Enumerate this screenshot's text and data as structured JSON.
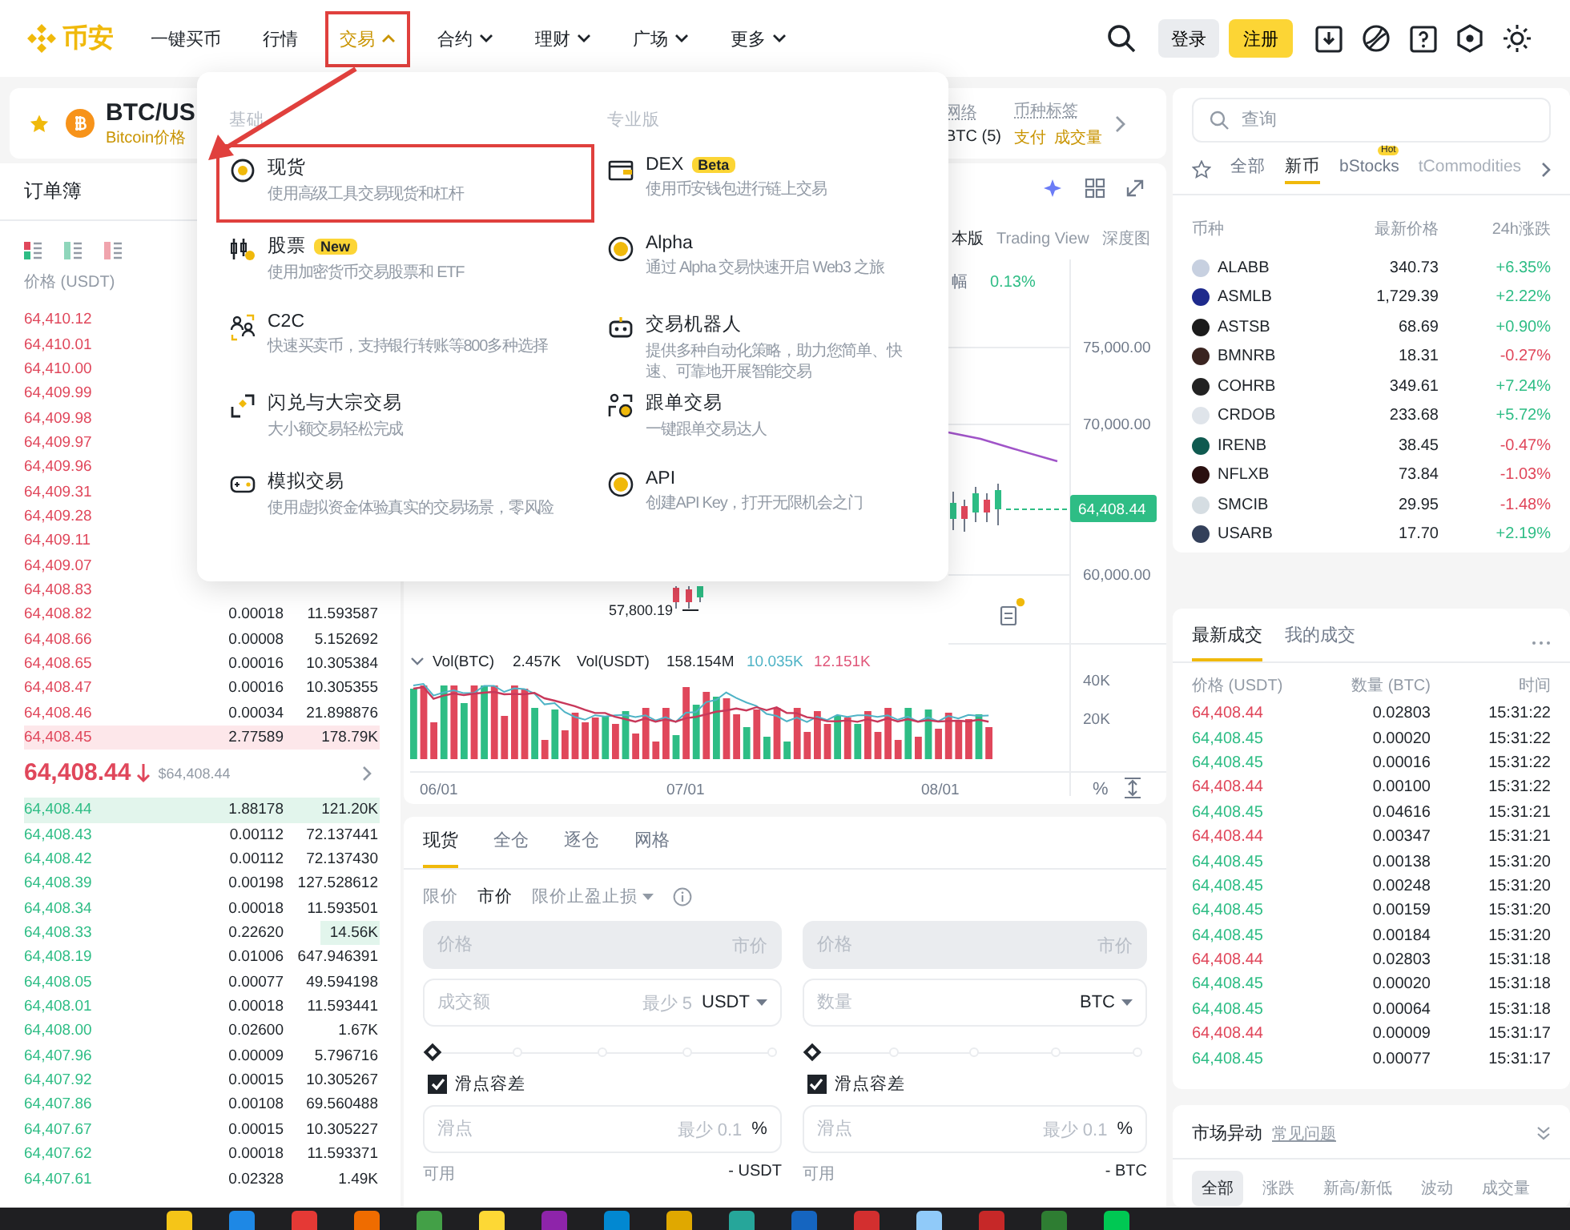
{
  "nav": {
    "logo": "币安",
    "items": [
      {
        "label": "一键买币",
        "kind": "link",
        "highlighted": false
      },
      {
        "label": "行情",
        "kind": "link",
        "highlighted": false
      },
      {
        "label": "交易",
        "kind": "dropdown",
        "expanded": true,
        "highlighted": true
      },
      {
        "label": "合约",
        "kind": "dropdown",
        "expanded": false,
        "highlighted": false
      },
      {
        "label": "理财",
        "kind": "dropdown",
        "expanded": false,
        "highlighted": false
      },
      {
        "label": "广场",
        "kind": "dropdown",
        "expanded": false,
        "highlighted": false
      },
      {
        "label": "更多",
        "kind": "dropdown",
        "expanded": false,
        "highlighted": false
      }
    ],
    "login": "登录",
    "register": "注册"
  },
  "pair": {
    "symbol": "BTC/US",
    "subtitle": "Bitcoin价格",
    "network": {
      "label": "网络",
      "value": "BTC (5)"
    },
    "tags": {
      "label": "币种标签",
      "values": [
        "支付",
        "成交量"
      ]
    }
  },
  "orderbook": {
    "title": "订单簿",
    "price_header": "价格 (USDT)",
    "asks": [
      {
        "price": "64,410.12"
      },
      {
        "price": "64,410.01"
      },
      {
        "price": "64,410.00"
      },
      {
        "price": "64,409.99"
      },
      {
        "price": "64,409.98"
      },
      {
        "price": "64,409.97"
      },
      {
        "price": "64,409.96"
      },
      {
        "price": "64,409.31"
      },
      {
        "price": "64,409.28"
      },
      {
        "price": "64,409.11"
      },
      {
        "price": "64,409.07"
      },
      {
        "price": "64,408.83"
      },
      {
        "price": "64,408.82",
        "amount": "0.00018",
        "total": "11.593587"
      },
      {
        "price": "64,408.66",
        "amount": "0.00008",
        "total": "5.152692"
      },
      {
        "price": "64,408.65",
        "amount": "0.00016",
        "total": "10.305384"
      },
      {
        "price": "64,408.47",
        "amount": "0.00016",
        "total": "10.305355"
      },
      {
        "price": "64,408.46",
        "amount": "0.00034",
        "total": "21.898876"
      },
      {
        "price": "64,408.45",
        "amount": "2.77589",
        "total": "178.79K",
        "highlighted": true
      }
    ],
    "mid": {
      "price": "64,408.44",
      "falling": true,
      "usd": "$64,408.44"
    },
    "bids": [
      {
        "price": "64,408.44",
        "amount": "1.88178",
        "total": "121.20K",
        "highlighted": true
      },
      {
        "price": "64,408.43",
        "amount": "0.00112",
        "total": "72.137441"
      },
      {
        "price": "64,408.42",
        "amount": "0.00112",
        "total": "72.137430"
      },
      {
        "price": "64,408.39",
        "amount": "0.00198",
        "total": "127.528612"
      },
      {
        "price": "64,408.34",
        "amount": "0.00018",
        "total": "11.593501"
      },
      {
        "price": "64,408.33",
        "amount": "0.22620",
        "total": "14.56K",
        "total_highlighted": true
      },
      {
        "price": "64,408.19",
        "amount": "0.01006",
        "total": "647.946391"
      },
      {
        "price": "64,408.05",
        "amount": "0.00077",
        "total": "49.594198"
      },
      {
        "price": "64,408.01",
        "amount": "0.00018",
        "total": "11.593441"
      },
      {
        "price": "64,408.00",
        "amount": "0.02600",
        "total": "1.67K"
      },
      {
        "price": "64,407.96",
        "amount": "0.00009",
        "total": "5.796716"
      },
      {
        "price": "64,407.92",
        "amount": "0.00015",
        "total": "10.305267"
      },
      {
        "price": "64,407.86",
        "amount": "0.00108",
        "total": "69.560488"
      },
      {
        "price": "64,407.67",
        "amount": "0.00015",
        "total": "10.305227"
      },
      {
        "price": "64,407.62",
        "amount": "0.00018",
        "total": "11.593371"
      },
      {
        "price": "64,407.61",
        "amount": "0.02328",
        "total": "1.49K"
      }
    ]
  },
  "menu": {
    "sections": [
      {
        "title": "基础",
        "items": [
          {
            "title": "现货",
            "description": "使用高级工具交易现货和杠杆",
            "highlighted": true
          },
          {
            "title": "股票",
            "badge": "New",
            "description": "使用加密货币交易股票和 ETF",
            "highlighted": false
          },
          {
            "title": "C2C",
            "description": "快速买卖币，支持银行转账等800多种选择",
            "highlighted": false
          },
          {
            "title": "闪兑与大宗交易",
            "description": "大小额交易轻松完成",
            "highlighted": false
          },
          {
            "title": "模拟交易",
            "description": "使用虚拟资金体验真实的交易场景，零风险",
            "highlighted": false
          }
        ]
      },
      {
        "title": "专业版",
        "items": [
          {
            "title": "DEX",
            "badge": "Beta",
            "description": "使用币安钱包进行链上交易",
            "highlighted": false
          },
          {
            "title": "Alpha",
            "description": "通过 Alpha 交易快速开启 Web3 之旅",
            "highlighted": false
          },
          {
            "title": "交易机器人",
            "description": "提供多种自动化策略，助力您简单、快速、可靠地开展智能交易",
            "highlighted": false
          },
          {
            "title": "跟单交易",
            "description": "一键跟单交易达人",
            "highlighted": false
          },
          {
            "title": "API",
            "description": "创建API Key，打开无限机会之门",
            "highlighted": false
          }
        ]
      }
    ]
  },
  "chart": {
    "views": [
      {
        "label": "本版",
        "selected": true
      },
      {
        "label": "Trading View",
        "selected": false
      },
      {
        "label": "深度图",
        "selected": false
      }
    ],
    "amplitude": {
      "label": "幅",
      "value": "0.13%"
    },
    "price_ticks": [
      "75,000.00",
      "70,000.00",
      "60,000.00"
    ],
    "last_price": "64,408.44",
    "low_label": "57,800.19",
    "volume_legend": [
      {
        "label": "Vol(BTC)",
        "value": "2.457K"
      },
      {
        "label": "Vol(USDT)",
        "value": "158.154M"
      }
    ],
    "ma_values": [
      {
        "value": "10.035K",
        "color": "#4fb3c6"
      },
      {
        "value": "12.151K",
        "color": "#e0577a"
      }
    ],
    "volume_ticks": [
      "40K",
      "20K"
    ],
    "dates": [
      "06/01",
      "07/01",
      "08/01"
    ],
    "percent": "%"
  },
  "trade": {
    "tabs": [
      {
        "label": "现货",
        "selected": true
      },
      {
        "label": "全仓",
        "selected": false
      },
      {
        "label": "逐仓",
        "selected": false
      },
      {
        "label": "网格",
        "selected": false
      }
    ],
    "order_types": [
      {
        "label": "限价",
        "selected": false,
        "kind": "tab"
      },
      {
        "label": "市价",
        "selected": true,
        "kind": "tab"
      },
      {
        "label": "限价止盈止损",
        "selected": false,
        "kind": "dropdown"
      }
    ],
    "sides": [
      {
        "price": {
          "placeholder": "价格",
          "suffix": "市价"
        },
        "amount": {
          "placeholder": "成交额",
          "hint": "最少 5",
          "unit": "USDT"
        },
        "level": 0,
        "slippage": {
          "label": "滑点容差",
          "checked": true,
          "placeholder": "滑点",
          "hint": "最少 0.1",
          "unit": "%"
        },
        "available": {
          "label": "可用",
          "value": "- USDT"
        }
      },
      {
        "price": {
          "placeholder": "价格",
          "suffix": "市价"
        },
        "amount": {
          "placeholder": "数量",
          "unit": "BTC"
        },
        "level": 0,
        "slippage": {
          "label": "滑点容差",
          "checked": true,
          "placeholder": "滑点",
          "hint": "最少 0.1",
          "unit": "%"
        },
        "available": {
          "label": "可用",
          "value": "- BTC"
        }
      }
    ]
  },
  "market": {
    "search": {
      "placeholder": "查询"
    },
    "tabs": [
      {
        "label": "全部",
        "selected": false
      },
      {
        "label": "新币",
        "selected": true
      },
      {
        "label": "bStocks",
        "selected": false,
        "badge": "Hot"
      },
      {
        "label": "tCommodities",
        "selected": false
      }
    ],
    "columns": [
      "币种",
      "最新价格",
      "24h涨跌"
    ],
    "rows": [
      {
        "symbol": "ALABB",
        "price": "340.73",
        "change": "+6.35%",
        "rising": true,
        "color": "#c7d0e0"
      },
      {
        "symbol": "ASMLB",
        "price": "1,729.39",
        "change": "+2.22%",
        "rising": true,
        "color": "#1e2a8c"
      },
      {
        "symbol": "ASTSB",
        "price": "68.69",
        "change": "+0.90%",
        "rising": true,
        "color": "#1b1b1b"
      },
      {
        "symbol": "BMNRB",
        "price": "18.31",
        "change": "-0.27%",
        "rising": false,
        "color": "#3a2420"
      },
      {
        "symbol": "COHRB",
        "price": "349.61",
        "change": "+7.24%",
        "rising": true,
        "color": "#222222"
      },
      {
        "symbol": "CRDOB",
        "price": "233.68",
        "change": "+5.72%",
        "rising": true,
        "color": "#dfe4ea"
      },
      {
        "symbol": "IRENB",
        "price": "38.45",
        "change": "-0.47%",
        "rising": false,
        "color": "#0f5a50"
      },
      {
        "symbol": "NFLXB",
        "price": "73.84",
        "change": "-1.03%",
        "rising": false,
        "color": "#2a1010"
      },
      {
        "symbol": "SMCIB",
        "price": "29.95",
        "change": "-1.48%",
        "rising": false,
        "color": "#d5dde2"
      },
      {
        "symbol": "USARB",
        "price": "17.70",
        "change": "+2.19%",
        "rising": true,
        "color": "#33405a"
      }
    ]
  },
  "trades": {
    "tabs": [
      {
        "label": "最新成交",
        "selected": true
      },
      {
        "label": "我的成交",
        "selected": false
      }
    ],
    "columns": [
      "价格 (USDT)",
      "数量 (BTC)",
      "时间"
    ],
    "rows": [
      {
        "price": "64,408.44",
        "amount": "0.02803",
        "time": "15:31:22",
        "buy": false
      },
      {
        "price": "64,408.45",
        "amount": "0.00020",
        "time": "15:31:22",
        "buy": true
      },
      {
        "price": "64,408.45",
        "amount": "0.00016",
        "time": "15:31:22",
        "buy": true
      },
      {
        "price": "64,408.44",
        "amount": "0.00100",
        "time": "15:31:22",
        "buy": false
      },
      {
        "price": "64,408.45",
        "amount": "0.04616",
        "time": "15:31:21",
        "buy": true
      },
      {
        "price": "64,408.44",
        "amount": "0.00347",
        "time": "15:31:21",
        "buy": false
      },
      {
        "price": "64,408.45",
        "amount": "0.00138",
        "time": "15:31:20",
        "buy": true
      },
      {
        "price": "64,408.45",
        "amount": "0.00248",
        "time": "15:31:20",
        "buy": true
      },
      {
        "price": "64,408.45",
        "amount": "0.00159",
        "time": "15:31:20",
        "buy": true
      },
      {
        "price": "64,408.45",
        "amount": "0.00184",
        "time": "15:31:20",
        "buy": true
      },
      {
        "price": "64,408.44",
        "amount": "0.02803",
        "time": "15:31:18",
        "buy": false
      },
      {
        "price": "64,408.45",
        "amount": "0.00020",
        "time": "15:31:18",
        "buy": true
      },
      {
        "price": "64,408.45",
        "amount": "0.00064",
        "time": "15:31:18",
        "buy": true
      },
      {
        "price": "64,408.44",
        "amount": "0.00009",
        "time": "15:31:17",
        "buy": false
      },
      {
        "price": "64,408.45",
        "amount": "0.00077",
        "time": "15:31:17",
        "buy": true
      }
    ]
  },
  "movement": {
    "title": "市场异动",
    "link": "常见问题",
    "tabs": [
      {
        "label": "全部",
        "selected": true
      },
      {
        "label": "涨跌",
        "selected": false
      },
      {
        "label": "新高/新低",
        "selected": false
      },
      {
        "label": "波动",
        "selected": false
      },
      {
        "label": "成交量",
        "selected": false
      }
    ]
  }
}
